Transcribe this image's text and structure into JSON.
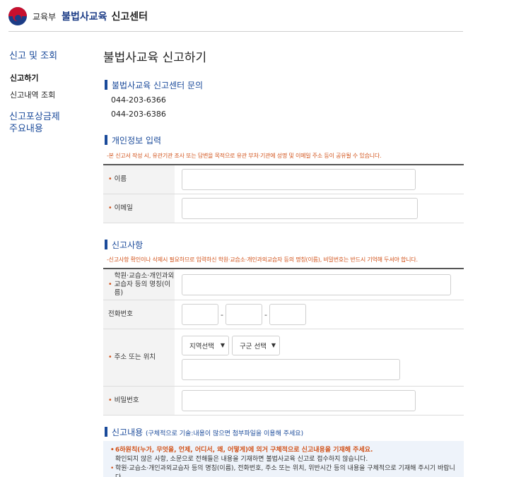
{
  "header": {
    "ministry": "교육부",
    "title_blue": "불법사교육",
    "title_black": "신고센터"
  },
  "sidebar": {
    "title": "신고 및 조회",
    "items": [
      {
        "label": "신고하기"
      },
      {
        "label": "신고내역 조회"
      }
    ],
    "reward_line1": "신고포상금제",
    "reward_line2": "주요내용"
  },
  "main": {
    "page_title": "불법사교육 신고하기",
    "contact": {
      "title": "불법사교육 신고센터 문의",
      "phone1": "044-203-6366",
      "phone2": "044-203-6386"
    },
    "personal": {
      "title": "개인정보 입력",
      "notice": "-본 신고서 작성 시, 유관기관 조사 또는 답변을 목적으로 유관 부처·기관에 성명 및 이메일 주소 등이 공유될 수 있습니다.",
      "name_label": "이름",
      "email_label": "이메일",
      "star": "•"
    },
    "report": {
      "title": "신고사항",
      "notice": "-신고사항 확인이나 삭제시 필요하므로 입력하신 학원·교습소·개인과외교습자 등의 명칭(이름), 비밀번호는 반드시 기억해 두셔야 합니다.",
      "academy_label": "학원·교습소·개인과외교습자 등의 명칭(이름)",
      "tel_label": "전화번호",
      "tel_dash": "-",
      "address_label": "주소 또는 위치",
      "region_select": "지역선택",
      "district_select": "구군 선택",
      "password_label": "비밀번호"
    },
    "content": {
      "title": "신고내용",
      "subtitle": "(구체적으로 기술:내용이 많으면 첨부파일을 이용해 주세요)",
      "line1": "6하원칙(누가, 무엇을, 언제, 어디서, 왜, 어떻게)에 의거 구체적으로 신고내용을 기재해 주세요.",
      "line2": "확인되지 않은 사항, 소문으로 전해들은 내용을 기재하면 불법사교육 신고로 접수하지 않습니다.",
      "line3": "학원·교습소·개인과외교습자 등의 명칭(이름), 전화번호, 주소 또는 위치, 위반시간 등의 내용을 구체적으로 기재해 주시기 바랍니다.",
      "bullet": "•"
    }
  },
  "colors": {
    "brand_blue": "#1a4a9a",
    "notice_orange": "#d2531b",
    "emblem_red": "#c8102e",
    "emblem_blue": "#1c3c86"
  }
}
